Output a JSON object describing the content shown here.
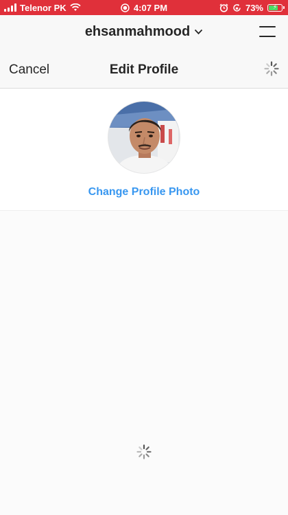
{
  "status_bar": {
    "carrier": "Telenor PK",
    "time": "4:07 PM",
    "battery": "73%",
    "icons": [
      "signal-icon",
      "wifi-icon",
      "recording-icon",
      "alarm-icon",
      "rotation-lock-icon",
      "battery-charging-icon"
    ]
  },
  "account": {
    "username": "ehsanmahmood"
  },
  "nav": {
    "cancel_label": "Cancel",
    "title": "Edit Profile"
  },
  "profile": {
    "change_photo_label": "Change Profile Photo"
  },
  "colors": {
    "status_bar_bg": "#e0303a",
    "link_blue": "#3897f0",
    "text_dark": "#262626"
  }
}
